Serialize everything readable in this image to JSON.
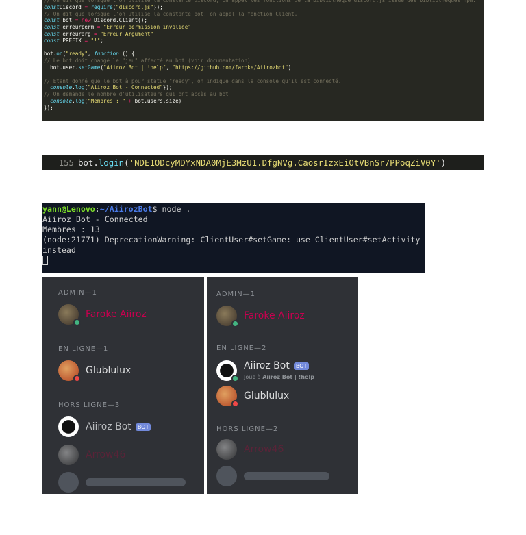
{
  "code": {
    "lines": [
      [
        [
          "c",
          "// On dit que lorsque l'on utilise la constante Discord, on appel les fonctions de la bibliotheque discord.js issue des bibliotheques npm."
        ]
      ],
      [
        [
          "k",
          "const"
        ],
        [
          "",
          "Discord "
        ],
        [
          "o",
          "="
        ],
        [
          "b",
          " require"
        ],
        [
          "",
          "("
        ],
        [
          "s",
          "\"discord.js\""
        ],
        [
          "",
          "});"
        ]
      ],
      [
        [
          "c",
          "// On dit que lorsque l'on utilise la constante bot, on appel la fonction Client."
        ]
      ],
      [
        [
          "k",
          "const"
        ],
        [
          "",
          " bot "
        ],
        [
          "o",
          "="
        ],
        [
          "o",
          " new"
        ],
        [
          "",
          " Discord.Client();"
        ]
      ],
      [
        [
          "k",
          "const"
        ],
        [
          "",
          " erreurperm "
        ],
        [
          "o",
          "="
        ],
        [
          "s",
          " \"Erreur permission invalide\""
        ]
      ],
      [
        [
          "k",
          "const"
        ],
        [
          "",
          " erreurarg "
        ],
        [
          "o",
          "="
        ],
        [
          "s",
          " \"Erreur Argument\""
        ]
      ],
      [
        [
          "k",
          "const"
        ],
        [
          "",
          " PREFIX "
        ],
        [
          "o",
          "="
        ],
        [
          "s",
          " \"!\""
        ],
        [
          "",
          ";"
        ]
      ],
      [],
      [
        [
          "",
          "bot."
        ],
        [
          "b",
          "on"
        ],
        [
          "",
          "("
        ],
        [
          "s",
          "\"ready\""
        ],
        [
          "",
          ", "
        ],
        [
          "k",
          "function"
        ],
        [
          "",
          " () {"
        ]
      ],
      [
        [
          "c",
          "// Le bot doit changé le \"jeu\" affecté au bot (voir documentation)"
        ]
      ],
      [
        [
          "",
          "  bot.user."
        ],
        [
          "b",
          "setGame"
        ],
        [
          "",
          "("
        ],
        [
          "s",
          "\"Aiiroz Bot | !help\""
        ],
        [
          "",
          ", "
        ],
        [
          "s",
          "\"https://github.com/faroke/Aiirozbot\""
        ],
        [
          "",
          ")"
        ]
      ],
      [],
      [
        [
          "c",
          "// Etant donné que le bot à pour statue \"ready\", on indique dans la console qu'il est connecté."
        ]
      ],
      [
        [
          "k",
          "  console"
        ],
        [
          "",
          "."
        ],
        [
          "b",
          "log"
        ],
        [
          "",
          "("
        ],
        [
          "s",
          "\"Aiiroz Bot - Connected\""
        ],
        [
          "",
          "});"
        ]
      ],
      [
        [
          "c",
          "// On demande le nombre d'utilisateurs qui ont accès au bot"
        ]
      ],
      [
        [
          "k",
          "  console"
        ],
        [
          "",
          "."
        ],
        [
          "b",
          "log"
        ],
        [
          "",
          "("
        ],
        [
          "s",
          "\"Membres : \""
        ],
        [
          "o",
          " +"
        ],
        [
          "",
          " bot.users.size)"
        ]
      ],
      [
        [
          "",
          "});"
        ]
      ]
    ]
  },
  "login": {
    "line_number": "155",
    "prefix": "bot.",
    "fn": "login",
    "open": "(",
    "token": "'NDE1ODcyMDYxNDA0MjE3MzU1.DfgNVg.CaosrIzxEiOtVBnSr7PPoqZiV0Y'",
    "close": ")"
  },
  "terminal": {
    "user": "yann@Lenovo",
    "sep": ":",
    "path": "~/AiirozBot",
    "cmd": "$ node .",
    "output": [
      "Aiiroz Bot - Connected",
      "Membres : 13",
      "(node:21771) DeprecationWarning: ClientUser#setGame: use ClientUser#setActivity",
      "instead"
    ]
  },
  "colors": {
    "admin": "#c8004f",
    "offline_name": "#5a2338",
    "online": "#43b581",
    "dnd": "#f04747",
    "bot_badge": "#7289da"
  },
  "panel_left": {
    "admin_header": "ADMIN—1",
    "online_header": "EN LIGNE—1",
    "offline_header": "HORS LIGNE—3",
    "admin": "Faroke Aiiroz",
    "online": [
      "Glublulux"
    ],
    "offline": [
      "Aiiroz Bot",
      "Arrow46"
    ],
    "bot_badge": "BOT"
  },
  "panel_right": {
    "admin_header": "ADMIN—1",
    "online_header": "EN LIGNE—2",
    "offline_header": "HORS LIGNE—2",
    "admin": "Faroke Aiiroz",
    "online": [
      "Aiiroz Bot",
      "Glublulux"
    ],
    "bot_activity_prefix": "Joue à ",
    "bot_activity": "Aiiroz Bot | !help",
    "offline": [
      "Arrow46"
    ],
    "bot_badge": "BOT"
  }
}
